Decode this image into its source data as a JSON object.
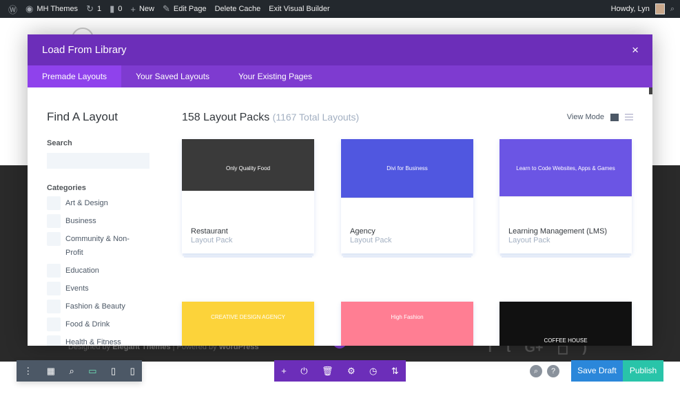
{
  "adminbar": {
    "site": "MH Themes",
    "updates": "1",
    "comments": "0",
    "new": "New",
    "edit": "Edit Page",
    "cache": "Delete Cache",
    "exit": "Exit Visual Builder",
    "howdy": "Howdy, Lyn"
  },
  "footer": {
    "designed": "Designed by",
    "et": "Elegant Themes",
    "sep": " | Powered by ",
    "wp": "WordPress"
  },
  "modal": {
    "title": "Load From Library",
    "close": "×",
    "tabs": [
      "Premade Layouts",
      "Your Saved Layouts",
      "Your Existing Pages"
    ],
    "sidebar": {
      "title": "Find A Layout",
      "search_label": "Search",
      "search_value": "",
      "categories_label": "Categories",
      "categories": [
        "Art & Design",
        "Business",
        "Community & Non-Profit",
        "Education",
        "Events",
        "Fashion & Beauty",
        "Food & Drink",
        "Health & Fitness"
      ]
    },
    "main": {
      "count": "158 Layout Packs",
      "total": "(1167 Total Layouts)",
      "view_mode": "View Mode",
      "cards": [
        {
          "name": "Restaurant",
          "sub": "Layout Pack",
          "thumb": "Only Quality Food",
          "bg": "#3a3a3a"
        },
        {
          "name": "Agency",
          "sub": "Layout Pack",
          "thumb": "Divi for Business",
          "bg": "#5057e0"
        },
        {
          "name": "Learning Management (LMS)",
          "sub": "Layout Pack",
          "thumb": "Learn to Code Websites, Apps & Games",
          "bg": "#6b55e4"
        },
        {
          "thumb": "CREATIVE DESIGN AGENCY",
          "bg": "#fcd33a"
        },
        {
          "thumb": "High Fashion",
          "bg": "#ff7e93"
        },
        {
          "thumb": "COFFEE HOUSE",
          "bg": "#111111"
        }
      ]
    }
  },
  "toolbar": {
    "save_draft": "Save Draft",
    "publish": "Publish",
    "help": "?"
  },
  "colors": {
    "purple": "#6c2eb9",
    "tab": "#7e3bd0",
    "tab_active": "#8f42ec",
    "save": "#2b87da",
    "publish": "#29c4a9"
  }
}
